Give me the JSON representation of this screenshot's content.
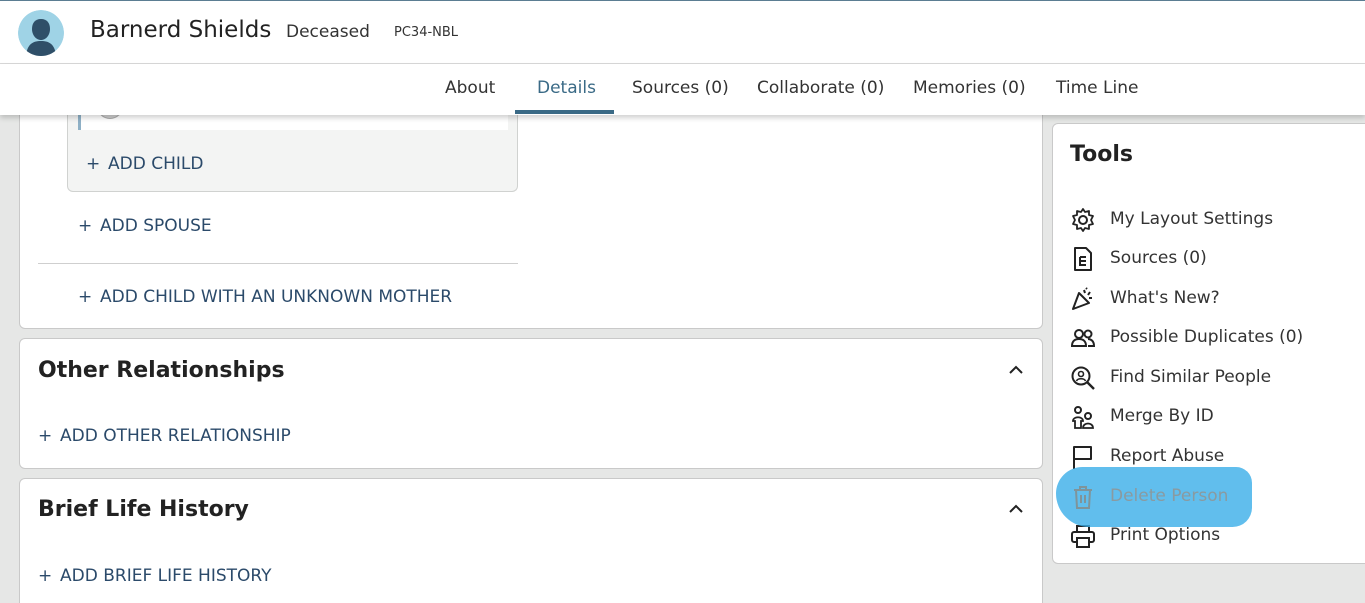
{
  "header": {
    "name": "Barnerd Shields",
    "status": "Deceased",
    "person_id": "PC34-NBL"
  },
  "tabs": [
    {
      "label": "About"
    },
    {
      "label": "Details"
    },
    {
      "label": "Sources (0)"
    },
    {
      "label": "Collaborate (0)"
    },
    {
      "label": "Memories (0)"
    },
    {
      "label": "Time Line"
    }
  ],
  "active_tab": "Details",
  "family": {
    "add_child": "ADD CHILD",
    "add_spouse": "ADD SPOUSE",
    "add_child_unknown_mother": "ADD CHILD WITH AN UNKNOWN MOTHER"
  },
  "other_relationships": {
    "title": "Other Relationships",
    "add_label": "ADD OTHER RELATIONSHIP"
  },
  "brief_life_history": {
    "title": "Brief Life History",
    "add_label": "ADD BRIEF LIFE HISTORY"
  },
  "tools": {
    "title": "Tools",
    "items": [
      {
        "label": "My Layout Settings",
        "icon": "gear-icon"
      },
      {
        "label": "Sources (0)",
        "icon": "source-document-icon"
      },
      {
        "label": "What's New?",
        "icon": "party-popper-icon"
      },
      {
        "label": "Possible Duplicates (0)",
        "icon": "people-icon"
      },
      {
        "label": "Find Similar People",
        "icon": "person-search-icon"
      },
      {
        "label": "Merge By ID",
        "icon": "merge-people-icon"
      },
      {
        "label": "Report Abuse",
        "icon": "flag-icon"
      },
      {
        "label": "Delete Person",
        "icon": "trash-icon",
        "disabled": true
      },
      {
        "label": "Print Options",
        "icon": "printer-icon"
      }
    ]
  },
  "colors": {
    "accent": "#3a6a86",
    "link": "#2b4a6a",
    "highlight": "#3aaee8"
  }
}
